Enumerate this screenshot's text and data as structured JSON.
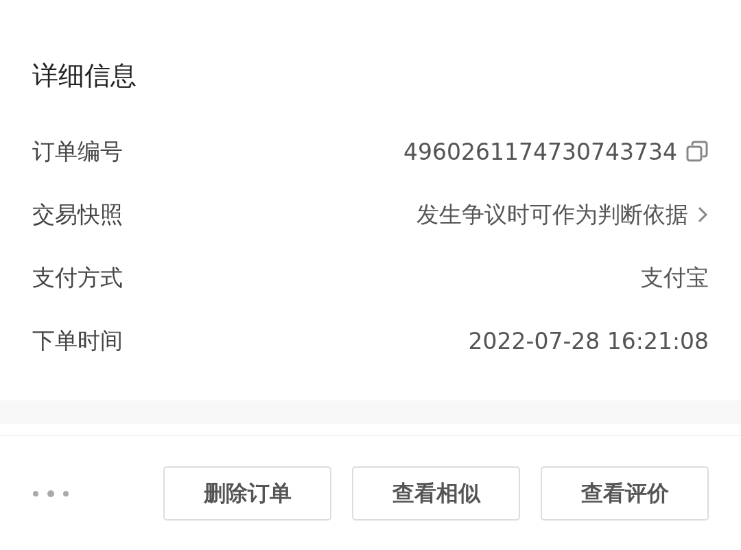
{
  "section": {
    "title": "详细信息"
  },
  "rows": [
    {
      "label": "订单编号",
      "value": "4960261174730743734",
      "kind": "copy"
    },
    {
      "label": "交易快照",
      "value": "发生争议时可作为判断依据",
      "kind": "link"
    },
    {
      "label": "支付方式",
      "value": "支付宝",
      "kind": "plain"
    },
    {
      "label": "下单时间",
      "value": "2022-07-28 16:21:08",
      "kind": "plain"
    }
  ],
  "buttons": [
    "删除订单",
    "查看相似",
    "查看评价"
  ]
}
